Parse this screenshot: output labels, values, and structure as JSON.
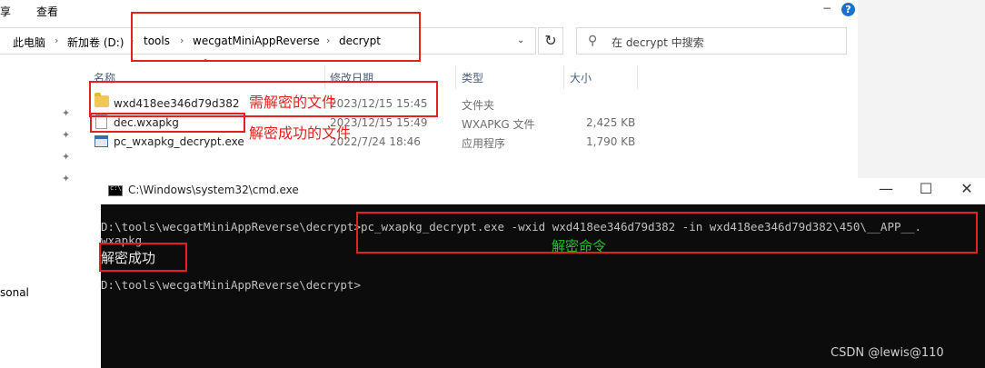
{
  "menubar": {
    "share": "享",
    "view": "查看"
  },
  "window_controls": {
    "minimize": "−",
    "help": "?"
  },
  "address": {
    "crumbs": [
      "此电脑",
      "新加卷 (D:)",
      "tools",
      "wecgatMiniAppReverse",
      "decrypt"
    ],
    "separator": "›",
    "dropdown": "⌄",
    "refresh": "↻"
  },
  "search": {
    "placeholder": "在 decrypt 中搜索",
    "icon": "search-icon"
  },
  "columns": {
    "name": "名称",
    "modified": "修改日期",
    "type": "类型",
    "size": "大小",
    "sort_arrow": "^"
  },
  "files": [
    {
      "name": "wxd418ee346d79d382",
      "modified": "2023/12/15 15:45",
      "type": "文件夹",
      "size": "",
      "icon": "folder-icon"
    },
    {
      "name": "dec.wxapkg",
      "modified": "2023/12/15 15:49",
      "type": "WXAPKG 文件",
      "size": "2,425 KB",
      "icon": "file-icon"
    },
    {
      "name": "pc_wxapkg_decrypt.exe",
      "modified": "2022/7/24 18:46",
      "type": "应用程序",
      "size": "1,790 KB",
      "icon": "exe-icon"
    }
  ],
  "pin_glyph": "✦",
  "sidebar": {
    "partial_label": "sonal"
  },
  "annotations": {
    "need_decrypt": "需解密的文件",
    "decrypt_success_file": "解密成功的文件",
    "decrypt_command": "解密命令",
    "color": "#e52020",
    "command_color": "#22c322"
  },
  "cmd": {
    "title": "C:\\Windows\\system32\\cmd.exe",
    "controls": {
      "minimize": "—",
      "maximize": "☐",
      "close": "✕"
    },
    "line1": "D:\\tools\\wecgatMiniAppReverse\\decrypt>pc_wxapkg_decrypt.exe -wxid wxd418ee346d79d382 -in wxd418ee346d79d382\\450\\__APP__.",
    "line2": "wxapkg",
    "success": "解密成功",
    "prompt": "D:\\tools\\wecgatMiniAppReverse\\decrypt>"
  },
  "watermark": "CSDN @lewis@110"
}
